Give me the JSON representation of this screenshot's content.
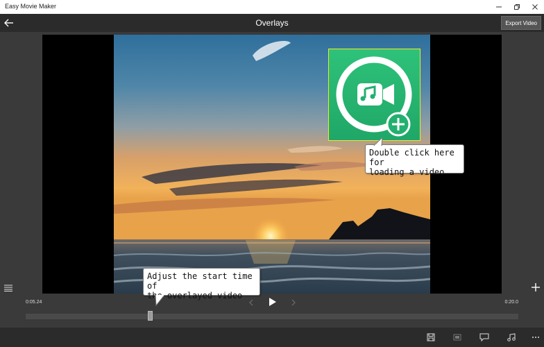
{
  "window": {
    "title": "Easy Movie Maker",
    "controls": [
      "minimize-icon",
      "restore-icon",
      "close-icon"
    ]
  },
  "header": {
    "back_icon": "back-arrow-icon",
    "title": "Overlays",
    "export_label": "Export Video"
  },
  "overlay": {
    "icon": "video-music-add-icon",
    "tile_color": "#22b06f",
    "border_color": "#f2e62a"
  },
  "callouts": {
    "load_video": [
      "Double click here for",
      "loading a video"
    ],
    "start_time": [
      "Adjust the start time of",
      "the overlayed video"
    ]
  },
  "side": {
    "left_icon": "list-icon",
    "right_icon": "add-icon"
  },
  "playback": {
    "current_time": "0:05.24",
    "end_time": "0:20.0",
    "prev_icon": "chevron-left-icon",
    "play_icon": "play-icon",
    "next_icon": "chevron-right-icon",
    "position_fraction": 0.25
  },
  "toolbar": {
    "icons": [
      "save-icon",
      "screen-icon",
      "comment-icon",
      "music-note-icon",
      "more-icon"
    ]
  }
}
